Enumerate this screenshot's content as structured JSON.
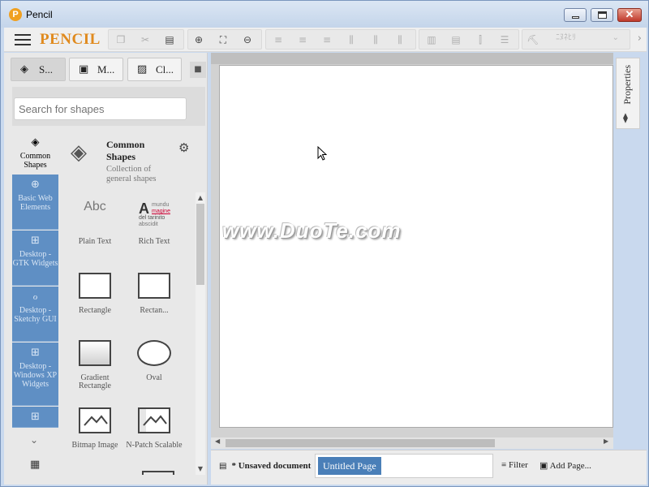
{
  "window": {
    "title": "Pencil",
    "app_icon_letter": "P",
    "close_glyph": "✕"
  },
  "toolbar": {
    "brand": "PENCIL",
    "font_placeholder": "ﾆﾇﾈﾋﾘ",
    "more": "›",
    "select_caret": "⌄"
  },
  "left_panel": {
    "tabs": [
      {
        "label": "S...",
        "icon": "layers-icon",
        "glyph": "◈"
      },
      {
        "label": "M...",
        "icon": "briefcase-icon",
        "glyph": "▣"
      },
      {
        "label": "Cl...",
        "icon": "image-icon",
        "glyph": "▨"
      }
    ],
    "pin_glyph": "■",
    "search_placeholder": "Search for shapes",
    "categories": [
      {
        "label": "Common Shapes",
        "glyph": "◈"
      },
      {
        "label": "Basic Web Elements",
        "glyph": "⊕"
      },
      {
        "label": "Desktop - GTK Widgets",
        "glyph": "⊞"
      },
      {
        "label": "Desktop - Sketchy GUI",
        "glyph": "ℴ"
      },
      {
        "label": "Desktop - Windows XP Widgets",
        "glyph": "⊞"
      },
      {
        "label": "",
        "glyph": "⊞"
      }
    ],
    "more_glyph": "⌄",
    "grid_glyph": "▦",
    "collection": {
      "title": "Common Shapes",
      "description": "Collection of general shapes",
      "glyph": "◈",
      "gear_glyph": "⚙"
    },
    "shapes": [
      {
        "label": "Plain Text",
        "preview": "Abc"
      },
      {
        "label": "Rich Text",
        "preview": "A",
        "rich_lines": [
          "mundu",
          "magine",
          "del tarinito",
          "abscidit"
        ]
      },
      {
        "label": "Rectangle"
      },
      {
        "label": "Rectan..."
      },
      {
        "label": "Gradient Rectangle"
      },
      {
        "label": "Oval"
      },
      {
        "label": "Bitmap Image"
      },
      {
        "label": "N-Patch Scalable"
      }
    ],
    "scroll_up": "▲",
    "scroll_down": "▼"
  },
  "canvas": {
    "watermark": "www.DuoTe.com"
  },
  "hscroll": {
    "left": "◀",
    "right": "▶"
  },
  "bottom": {
    "doc_status": "* Unsaved document",
    "doc_icon_glyph": "▤",
    "page_tab": "Untitled Page",
    "filter": "Filter",
    "filter_icon_glyph": "≡",
    "add_page": "Add Page...",
    "add_icon_glyph": "▣"
  },
  "properties": {
    "label": "Properties",
    "icon_glyph": "⧫"
  }
}
